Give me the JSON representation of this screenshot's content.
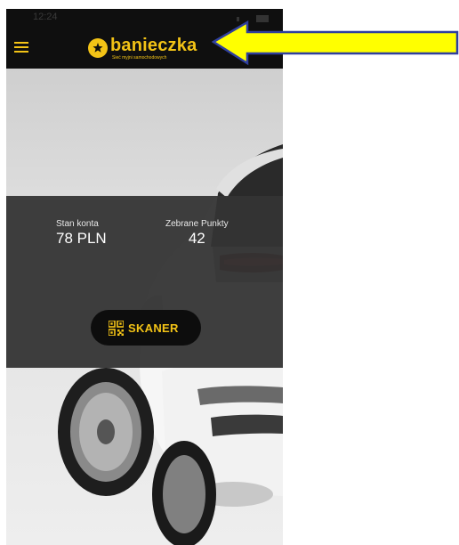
{
  "status_bar": {
    "time": "12:24"
  },
  "header": {
    "menu_icon": "hamburger-menu-icon",
    "logo": {
      "name": "banieczka",
      "tagline": "Sieć myjni samochodowych"
    }
  },
  "account": {
    "balance_label": "Stan konta",
    "balance_value": "78 PLN",
    "points_label": "Zebrane Punkty",
    "points_value": "42"
  },
  "scan_button": {
    "icon": "qr-code-icon",
    "label": "SKANER"
  },
  "annotation": {
    "arrow_color": "#ffff00",
    "arrow_border": "#2f3f9e"
  },
  "colors": {
    "brand_yellow": "#f3c316",
    "header_bg": "#0f0f0f",
    "panel_bg": "#343434"
  }
}
